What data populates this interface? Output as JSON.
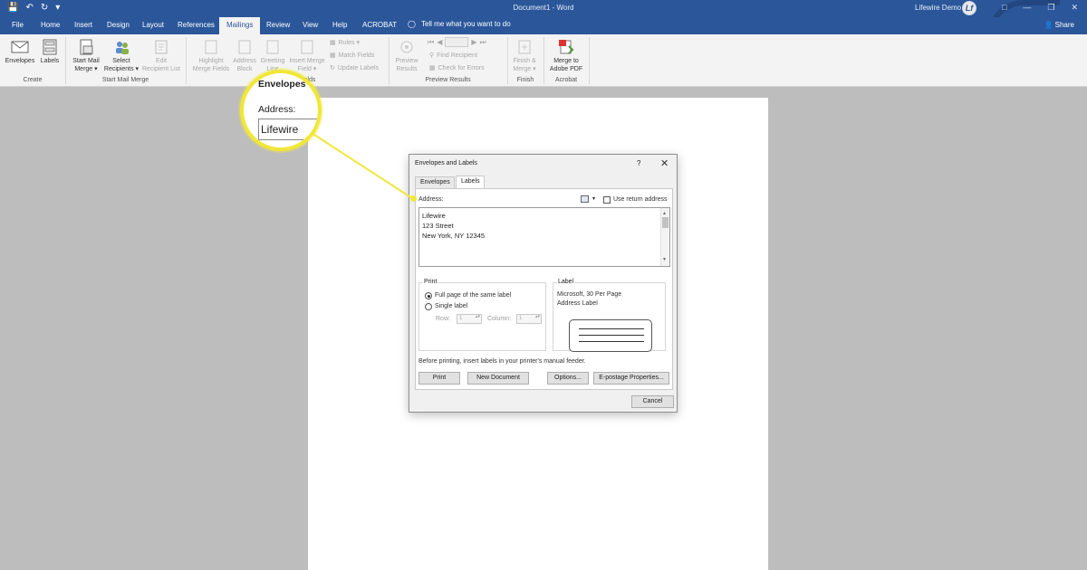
{
  "window": {
    "doc_title": "Document1 - Word",
    "user_name": "Lifewire Demo",
    "avatar_initials": "Lf",
    "share_label": "Share"
  },
  "tabs": [
    "File",
    "Home",
    "Insert",
    "Design",
    "Layout",
    "References",
    "Mailings",
    "Review",
    "View",
    "Help",
    "ACROBAT"
  ],
  "active_tab": "Mailings",
  "tell_me": "Tell me what you want to do",
  "ribbon": {
    "envelopes": "Envelopes",
    "labels": "Labels",
    "start_mail_merge": [
      "Start Mail",
      "Merge ▾"
    ],
    "select_recipients": [
      "Select",
      "Recipients ▾"
    ],
    "edit_recipient_list": [
      "Edit",
      "Recipient List"
    ],
    "highlight_merge_fields": [
      "Highlight",
      "Merge Fields"
    ],
    "address_block": [
      "Address",
      "Block"
    ],
    "greeting_line": [
      "Greeting",
      "Line"
    ],
    "insert_merge_field": [
      "Insert Merge",
      "Field ▾"
    ],
    "rules": "Rules ▾",
    "match_fields": "Match Fields",
    "update_labels": "Update Labels",
    "preview_results": [
      "Preview",
      "Results"
    ],
    "find_recipient": "Find Recipient",
    "check_for_errors": "Check for Errors",
    "finish_merge": [
      "Finish &",
      "Merge ▾"
    ],
    "merge_to_adobe_pdf": [
      "Merge to",
      "Adobe PDF"
    ],
    "groups": {
      "create": "Create",
      "start_mail_merge": "Start Mail Merge",
      "write_insert_fields": "Write & Insert Fields",
      "preview_results": "Preview Results",
      "finish": "Finish",
      "acrobat": "Acrobat"
    }
  },
  "dialog": {
    "title": "Envelopes and Labels",
    "help": "?",
    "close": "✕",
    "tabs": [
      "Envelopes",
      "Labels"
    ],
    "selected_tab": "Labels",
    "address_label": "Address:",
    "use_return_address": "Use return address",
    "address_lines": [
      "Lifewire",
      "123 Street",
      "New York, NY 12345"
    ],
    "print_group": "Print",
    "full_page": "Full page of the same label",
    "single_label": "Single label",
    "row_label": "Row:",
    "row_value": "1",
    "column_label": "Column:",
    "column_value": "1",
    "label_group": "Label",
    "label_vendor": "Microsoft, 30 Per Page",
    "label_product": "Address Label",
    "notice": "Before printing, insert labels in your printer's manual feeder.",
    "buttons": {
      "print": "Print",
      "new_document": "New Document",
      "options": "Options...",
      "epostage": "E-postage Properties...",
      "cancel": "Cancel"
    }
  },
  "magnifier": {
    "envelopes_text": "Envelopes",
    "address_text": "Address:",
    "value_text": "Lifewire"
  },
  "colors": {
    "titlebar": "#2b579a",
    "highlight": "#f0e73a"
  }
}
